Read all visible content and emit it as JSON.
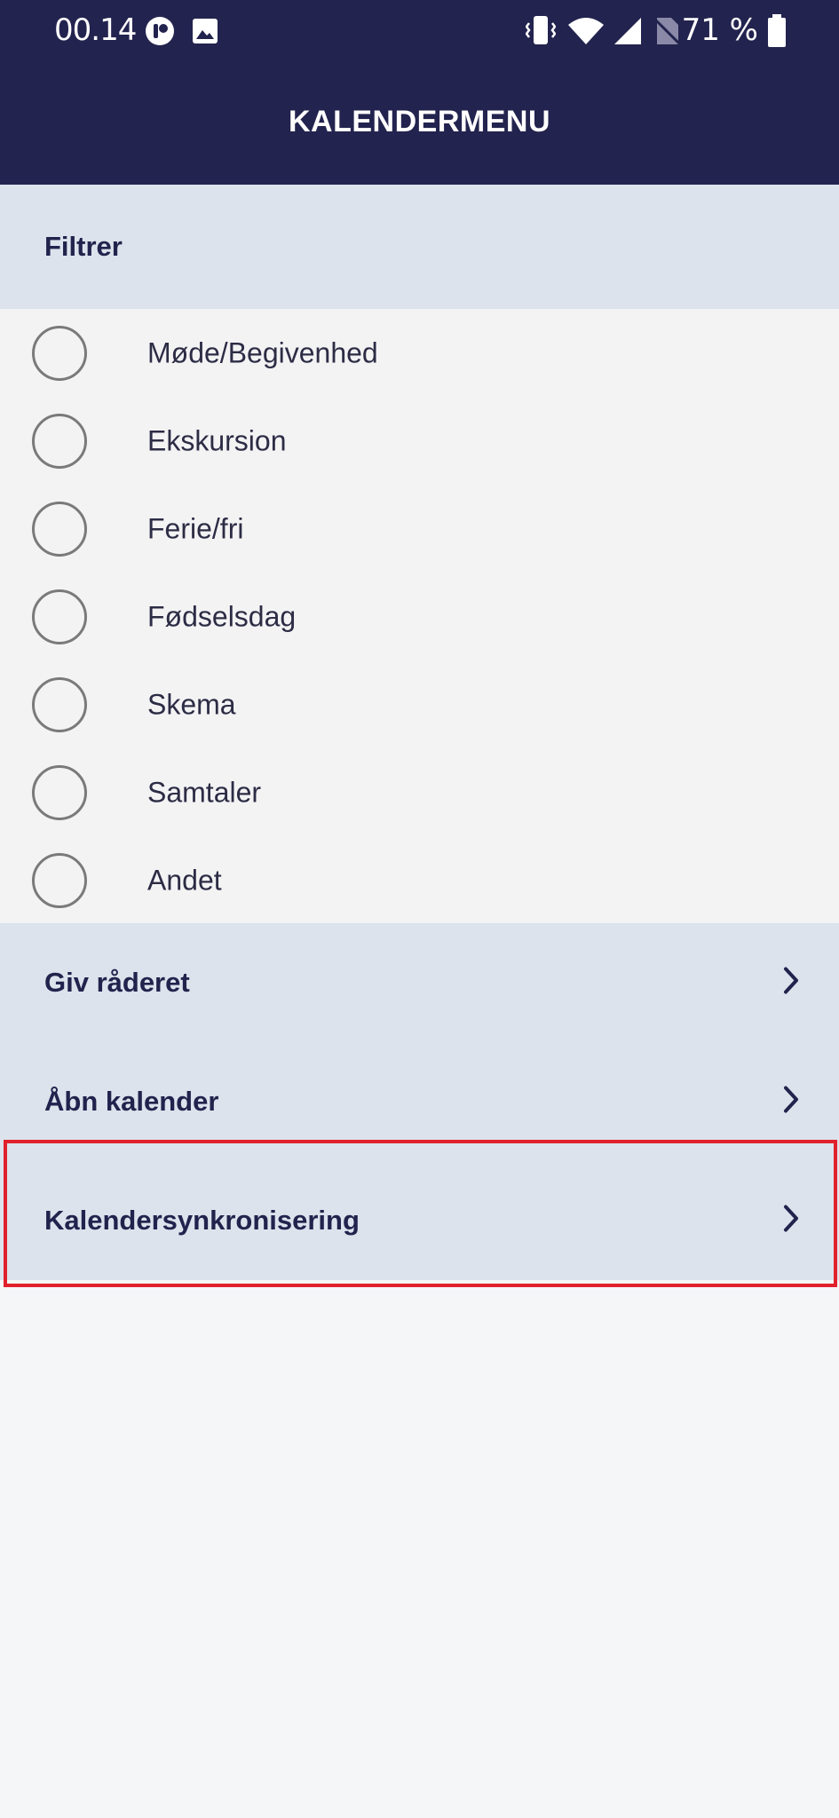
{
  "status_bar": {
    "time": "00.14",
    "battery": "71 %",
    "icons": [
      "notification-app-icon",
      "image-icon",
      "vibrate-icon",
      "wifi-icon",
      "signal-icon",
      "no-sim-icon",
      "battery-icon"
    ]
  },
  "app_bar": {
    "title": "KALENDERMENU"
  },
  "filter": {
    "header": "Filtrer",
    "items": [
      {
        "label": "Møde/Begivenhed"
      },
      {
        "label": "Ekskursion"
      },
      {
        "label": "Ferie/fri"
      },
      {
        "label": "Fødselsdag"
      },
      {
        "label": "Skema"
      },
      {
        "label": "Samtaler"
      },
      {
        "label": "Andet"
      }
    ]
  },
  "nav": {
    "items": [
      {
        "label": "Giv råderet"
      },
      {
        "label": "Åbn kalender"
      },
      {
        "label": "Kalendersynkronisering"
      }
    ]
  },
  "colors": {
    "app_bar": "#23234f",
    "section_bg": "#dce3ec",
    "list_bg": "#f4f3f4",
    "text_dark": "#22234d",
    "highlight": "#e0202b"
  }
}
